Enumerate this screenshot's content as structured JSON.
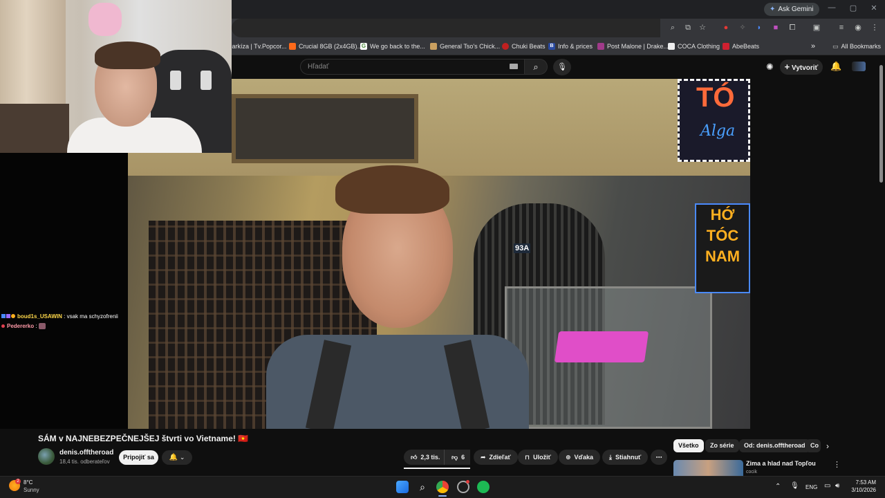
{
  "browser": {
    "gemini_label": "Ask Gemini",
    "window_controls": [
      "—",
      "▢",
      "✕"
    ],
    "bookmarks": [
      {
        "label": "Markíza | Tv.Popcor...",
        "color": "#3a3a3a"
      },
      {
        "label": "Crucial 8GB (2x4GB)...",
        "color": "#ff6a1a"
      },
      {
        "label": "We go back to the...",
        "color": "#4a8a3a"
      },
      {
        "label": "General Tso's Chick...",
        "color": "#caa060"
      },
      {
        "label": "Chuki Beats",
        "color": "#c02020"
      },
      {
        "label": "Info & prices",
        "color": "#2a4aa0"
      },
      {
        "label": "Post Malone | Drake...",
        "color": "#a03a8a"
      },
      {
        "label": "COCA Clothing",
        "color": "#222222"
      },
      {
        "label": "AbeBeats",
        "color": "#d02030"
      }
    ],
    "bookmarks_more": "»",
    "all_bookmarks": "All Bookmarks"
  },
  "youtube": {
    "search_placeholder": "Hľadať",
    "create_label": "Vytvoriť",
    "video": {
      "title": "SÁM v NAJNEBEZPEČNEJŠEJ štvrti vo Vietname! 🇻🇳",
      "sign_text_1": "TÓ",
      "sign_text_1b": "Alga",
      "sign_text_2": [
        "HỚ",
        "TÓC",
        "NAM"
      ],
      "door_number": "93A"
    },
    "channel": {
      "name": "denis.offtheroad",
      "subscribers": "18,4 tis. odberateľov",
      "join_label": "Pripojiť sa"
    },
    "actions": {
      "likes": "2,3 tis.",
      "dislikes": "6",
      "share": "Zdieľať",
      "save": "Uložiť",
      "thanks": "Vďaka",
      "download": "Stiahnuť"
    },
    "chips": [
      "Všetko",
      "Zo série",
      "Od: denis.offtheroad",
      "Co"
    ],
    "recommendation": {
      "title": "Zima a hlad nad Topľou",
      "channel": "cocik"
    }
  },
  "chat": {
    "messages": [
      {
        "user": "boud1s_USAWIN",
        "text": ": vsak ma schyzofrenii"
      },
      {
        "user": "Pedererko",
        "text": ":"
      }
    ]
  },
  "taskbar": {
    "weather_temp": "8°C",
    "weather_desc": "Sunny",
    "weather_badge": "2",
    "lang": "ENG",
    "time": "7:53 AM",
    "date": "3/10/2026"
  },
  "colors": {
    "youtube_bg": "#0f0f0f",
    "chrome_bar": "#35363a",
    "taskbar": "#1c1c1c",
    "chat_user_1": "#ffd84a",
    "chat_user_2": "#ff9aa8"
  }
}
